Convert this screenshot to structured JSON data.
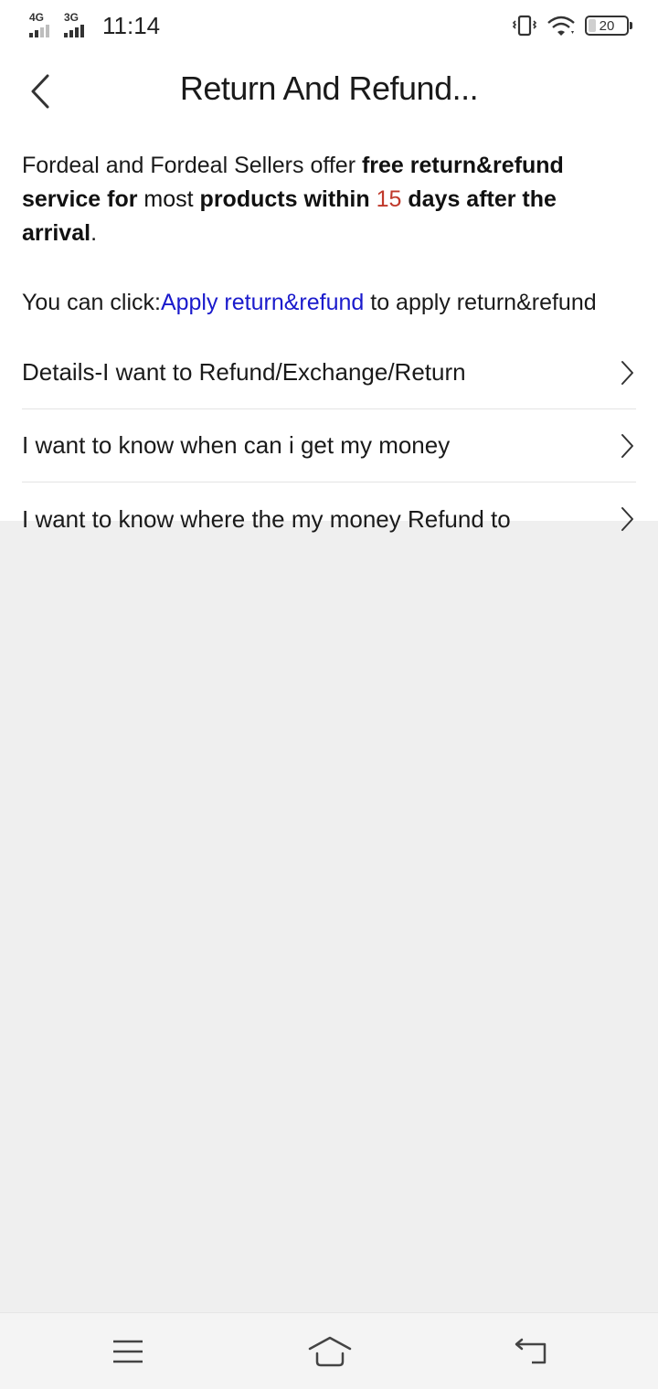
{
  "status_bar": {
    "network_1": "4G",
    "network_2": "3G",
    "time": "11:14",
    "battery": "20",
    "battery_level": 0.2
  },
  "header": {
    "title": "Return And Refund..."
  },
  "intro": {
    "part1": "Fordeal and Fordeal Sellers offer ",
    "bold1": "free return&refund service for ",
    "highlight1": "most",
    "bold2": " products within ",
    "highlight2": "15",
    "bold3": " days after the arrival",
    "end": "."
  },
  "apply": {
    "prefix": "You can click:",
    "link_label": "Apply return&refund",
    "suffix": " to apply return&refund"
  },
  "menu": {
    "items": [
      {
        "label": "Details-I want to Refund/Exchange/Return"
      },
      {
        "label": "I want to know when can i get my money"
      },
      {
        "label": "I want to know where the my money Refund to"
      }
    ]
  },
  "colors": {
    "accent_red": "#c0392b",
    "link_blue": "#1a1acc",
    "page_background": "#efefef"
  },
  "icons": {
    "back": "chevron-left-icon",
    "menu_chevron": "chevron-right-icon",
    "nav_menu": "hamburger-icon",
    "nav_home": "home-icon",
    "nav_back": "return-icon"
  }
}
